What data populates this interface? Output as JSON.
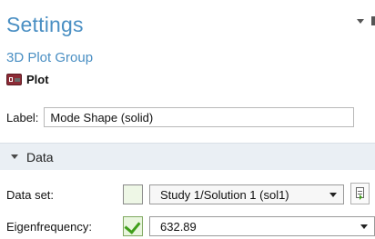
{
  "header": {
    "title": "Settings",
    "subtitle": "3D Plot Group",
    "plot_label": "Plot"
  },
  "label_field": {
    "label": "Label:",
    "value": "Mode Shape (solid)"
  },
  "section": {
    "title": "Data"
  },
  "dataset": {
    "label": "Data set:",
    "value": "Study 1/Solution 1 (sol1)"
  },
  "eigen": {
    "label": "Eigenfrequency:",
    "value": "632.89",
    "checked": true
  },
  "colors": {
    "accent": "#4a8fc3",
    "section_bg": "#eaeff4",
    "check_green": "#3f9e1a",
    "plot_icon": "#8c2b36"
  }
}
